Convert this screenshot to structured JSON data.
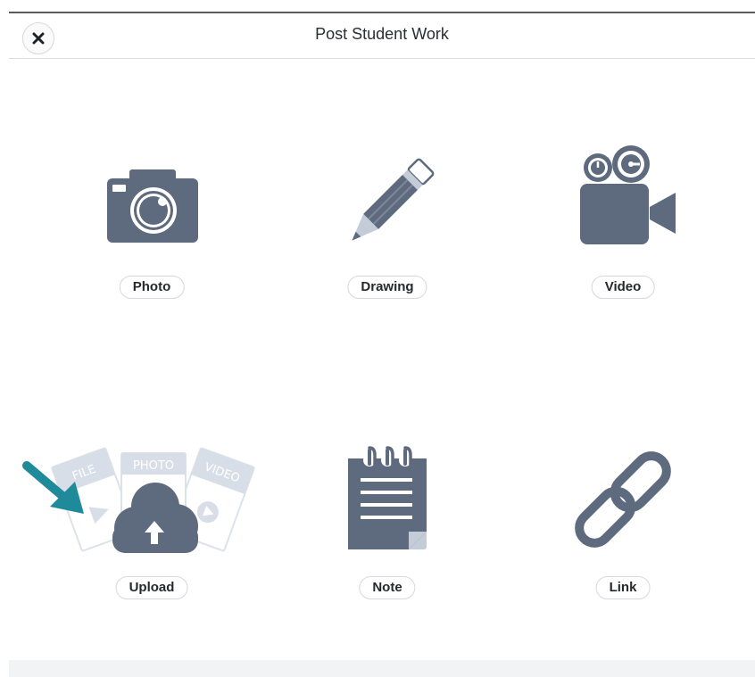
{
  "dialog": {
    "title": "Post Student Work",
    "close_icon": "close-icon"
  },
  "options": {
    "photo": {
      "label": "Photo",
      "icon": "camera-icon"
    },
    "drawing": {
      "label": "Drawing",
      "icon": "pencil-icon"
    },
    "video": {
      "label": "Video",
      "icon": "video-camera-icon"
    },
    "upload": {
      "label": "Upload",
      "icon": "cloud-upload-icon",
      "card_labels": {
        "file": "FILE",
        "photo": "PHOTO",
        "video": "VIDEO"
      }
    },
    "note": {
      "label": "Note",
      "icon": "notepad-icon"
    },
    "link": {
      "label": "Link",
      "icon": "link-icon"
    }
  },
  "colors": {
    "icon": "#5e6a7d",
    "icon_light": "#c4ccd8",
    "arrow": "#1f8a99"
  }
}
